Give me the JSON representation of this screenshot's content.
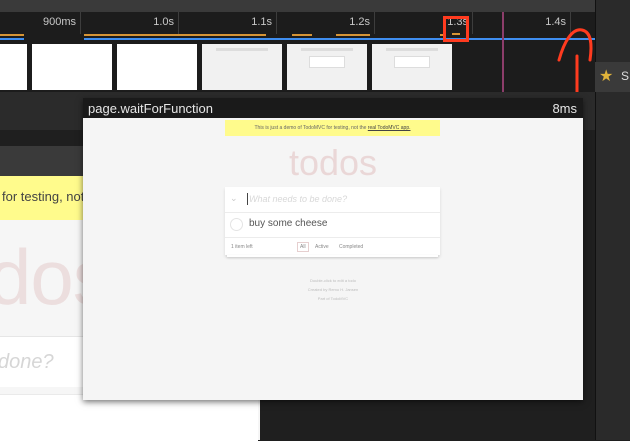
{
  "timeline": {
    "ticks": [
      {
        "label": "900ms"
      },
      {
        "label": "1.0s"
      },
      {
        "label": "1.1s"
      },
      {
        "label": "1.2s"
      },
      {
        "label": "1.3s"
      },
      {
        "label": "1.4s"
      }
    ]
  },
  "tooltip": {
    "title": "page.waitForFunction",
    "duration": "8ms"
  },
  "preview": {
    "banner": "This is just a demo of TodoMVC for testing, not the ",
    "banner_link": "real TodoMVC app.",
    "heading": "todos",
    "input_placeholder": "What needs to be done?",
    "toggle_icon": "chevron-down-icon",
    "todo_item": "buy some cheese",
    "items_left": "1 item left",
    "filters": [
      "All",
      "Active",
      "Completed"
    ],
    "info_lines": [
      "Double-click to edit a todo",
      "Created by Remo H. Jansen",
      "Part of TodoMVC"
    ]
  },
  "background_app": {
    "banner": "for testing, not t",
    "heading": "dos",
    "input_placeholder": "done?"
  },
  "right_panel": {
    "star_icon": "star-icon",
    "label": "S"
  },
  "colors": {
    "accent_orange": "#d69435",
    "accent_blue": "#3f8ef0",
    "annotation_red": "#ff3b1f",
    "banner_yellow": "#fffb8c"
  }
}
